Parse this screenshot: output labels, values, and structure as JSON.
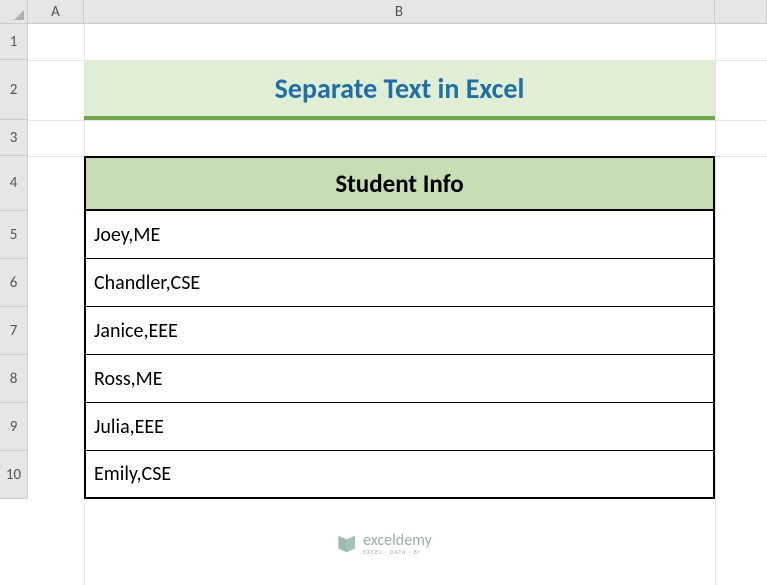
{
  "columns": [
    "A",
    "B"
  ],
  "rows": [
    "1",
    "2",
    "3",
    "4",
    "5",
    "6",
    "7",
    "8",
    "9",
    "10"
  ],
  "title": "Separate Text in Excel",
  "table": {
    "header": "Student Info",
    "data": [
      "Joey,ME",
      "Chandler,CSE",
      "Janice,EEE",
      "Ross,ME",
      "Julia,EEE",
      "Emily,CSE"
    ]
  },
  "watermark": {
    "main": "exceldemy",
    "sub": "EXCEL · DATA · BI"
  },
  "chart_data": {
    "type": "table",
    "title": "Separate Text in Excel",
    "columns": [
      "Student Info"
    ],
    "rows": [
      [
        "Joey,ME"
      ],
      [
        "Chandler,CSE"
      ],
      [
        "Janice,EEE"
      ],
      [
        "Ross,ME"
      ],
      [
        "Julia,EEE"
      ],
      [
        "Emily,CSE"
      ]
    ]
  }
}
